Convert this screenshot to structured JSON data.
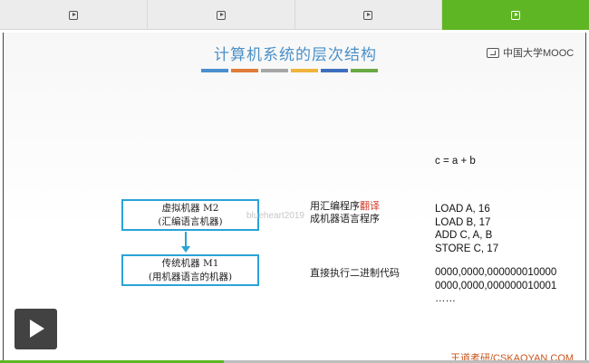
{
  "tabs": [
    {
      "icon": "play-icon",
      "active": false
    },
    {
      "icon": "play-icon",
      "active": false
    },
    {
      "icon": "play-icon",
      "active": false
    },
    {
      "icon": "play-icon",
      "active": true
    }
  ],
  "slide": {
    "title": "计算机系统的层次结构",
    "title_bar_colors": [
      "#4a8fd0",
      "#e07b39",
      "#a6a6a6",
      "#f0b43c",
      "#3d6fbf",
      "#6aaa45"
    ],
    "logo_text": "中国大学MOOC",
    "virtual_machine": {
      "line1": "虚拟机器 M2",
      "line2": "(汇编语言机器)"
    },
    "traditional_machine": {
      "line1": "传统机器 M1",
      "line2": "(用机器语言的机器)"
    },
    "translate_desc": {
      "prefix": "用汇编程序",
      "highlight": "翻译",
      "line2": "成机器语言程序"
    },
    "execute_desc": "直接执行二进制代码",
    "expression": "c = a + b",
    "assembly": [
      "LOAD A, 16",
      "LOAD B, 17",
      "ADD C, A, B",
      "STORE C, 17"
    ],
    "binary": [
      "0000,0000,000000010000",
      "0000,0000,000000010001",
      "……"
    ],
    "watermark": "blueheart2019",
    "brand": "王道考研/CSKAOYAN.COM"
  },
  "player": {
    "progress_fraction": 0.38,
    "colors": {
      "accent": "#5fb624",
      "box_border": "#29a3d8",
      "highlight": "#d43a2a"
    }
  }
}
